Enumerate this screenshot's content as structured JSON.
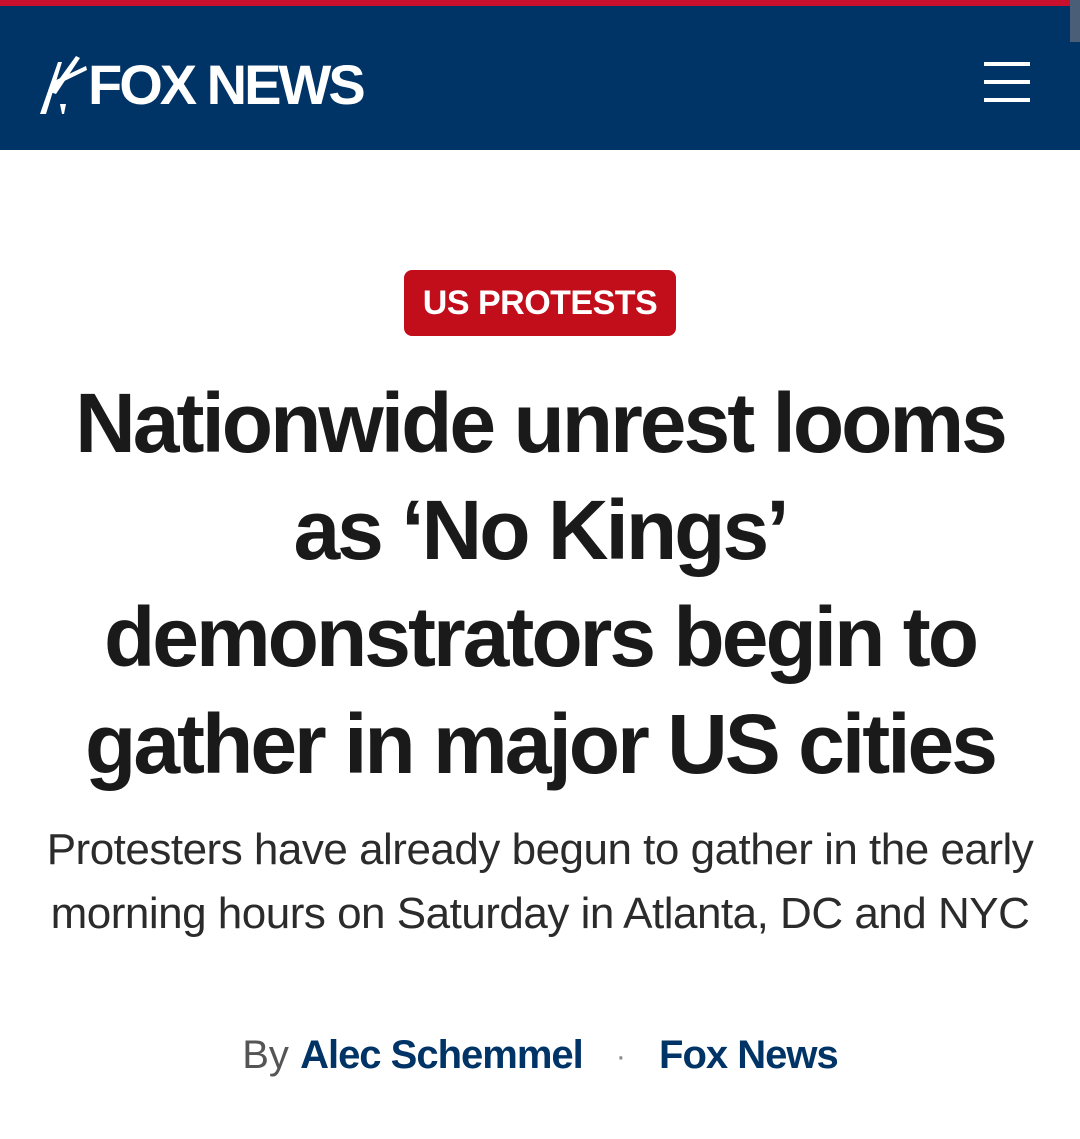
{
  "header": {
    "logo_text": "FOX NEWS",
    "logo_icon": "fox-news-searchlight-icon",
    "menu_icon": "hamburger-menu-icon",
    "background_color": "#003366",
    "accent_color": "#c8102e"
  },
  "article": {
    "category_badge": "US PROTESTS",
    "badge_color": "#c20e1a",
    "headline_lines": [
      "Nationwide unrest looms",
      "as ‘No Kings’",
      "demonstrators begin to",
      "gather in major US cities"
    ],
    "dek": "Protesters have already begun to gather in the early morning hours on Saturday in Atlanta, DC and NYC",
    "byline": {
      "prefix": "By",
      "author": "Alec Schemmel",
      "separator": "·",
      "source": "Fox News"
    }
  }
}
